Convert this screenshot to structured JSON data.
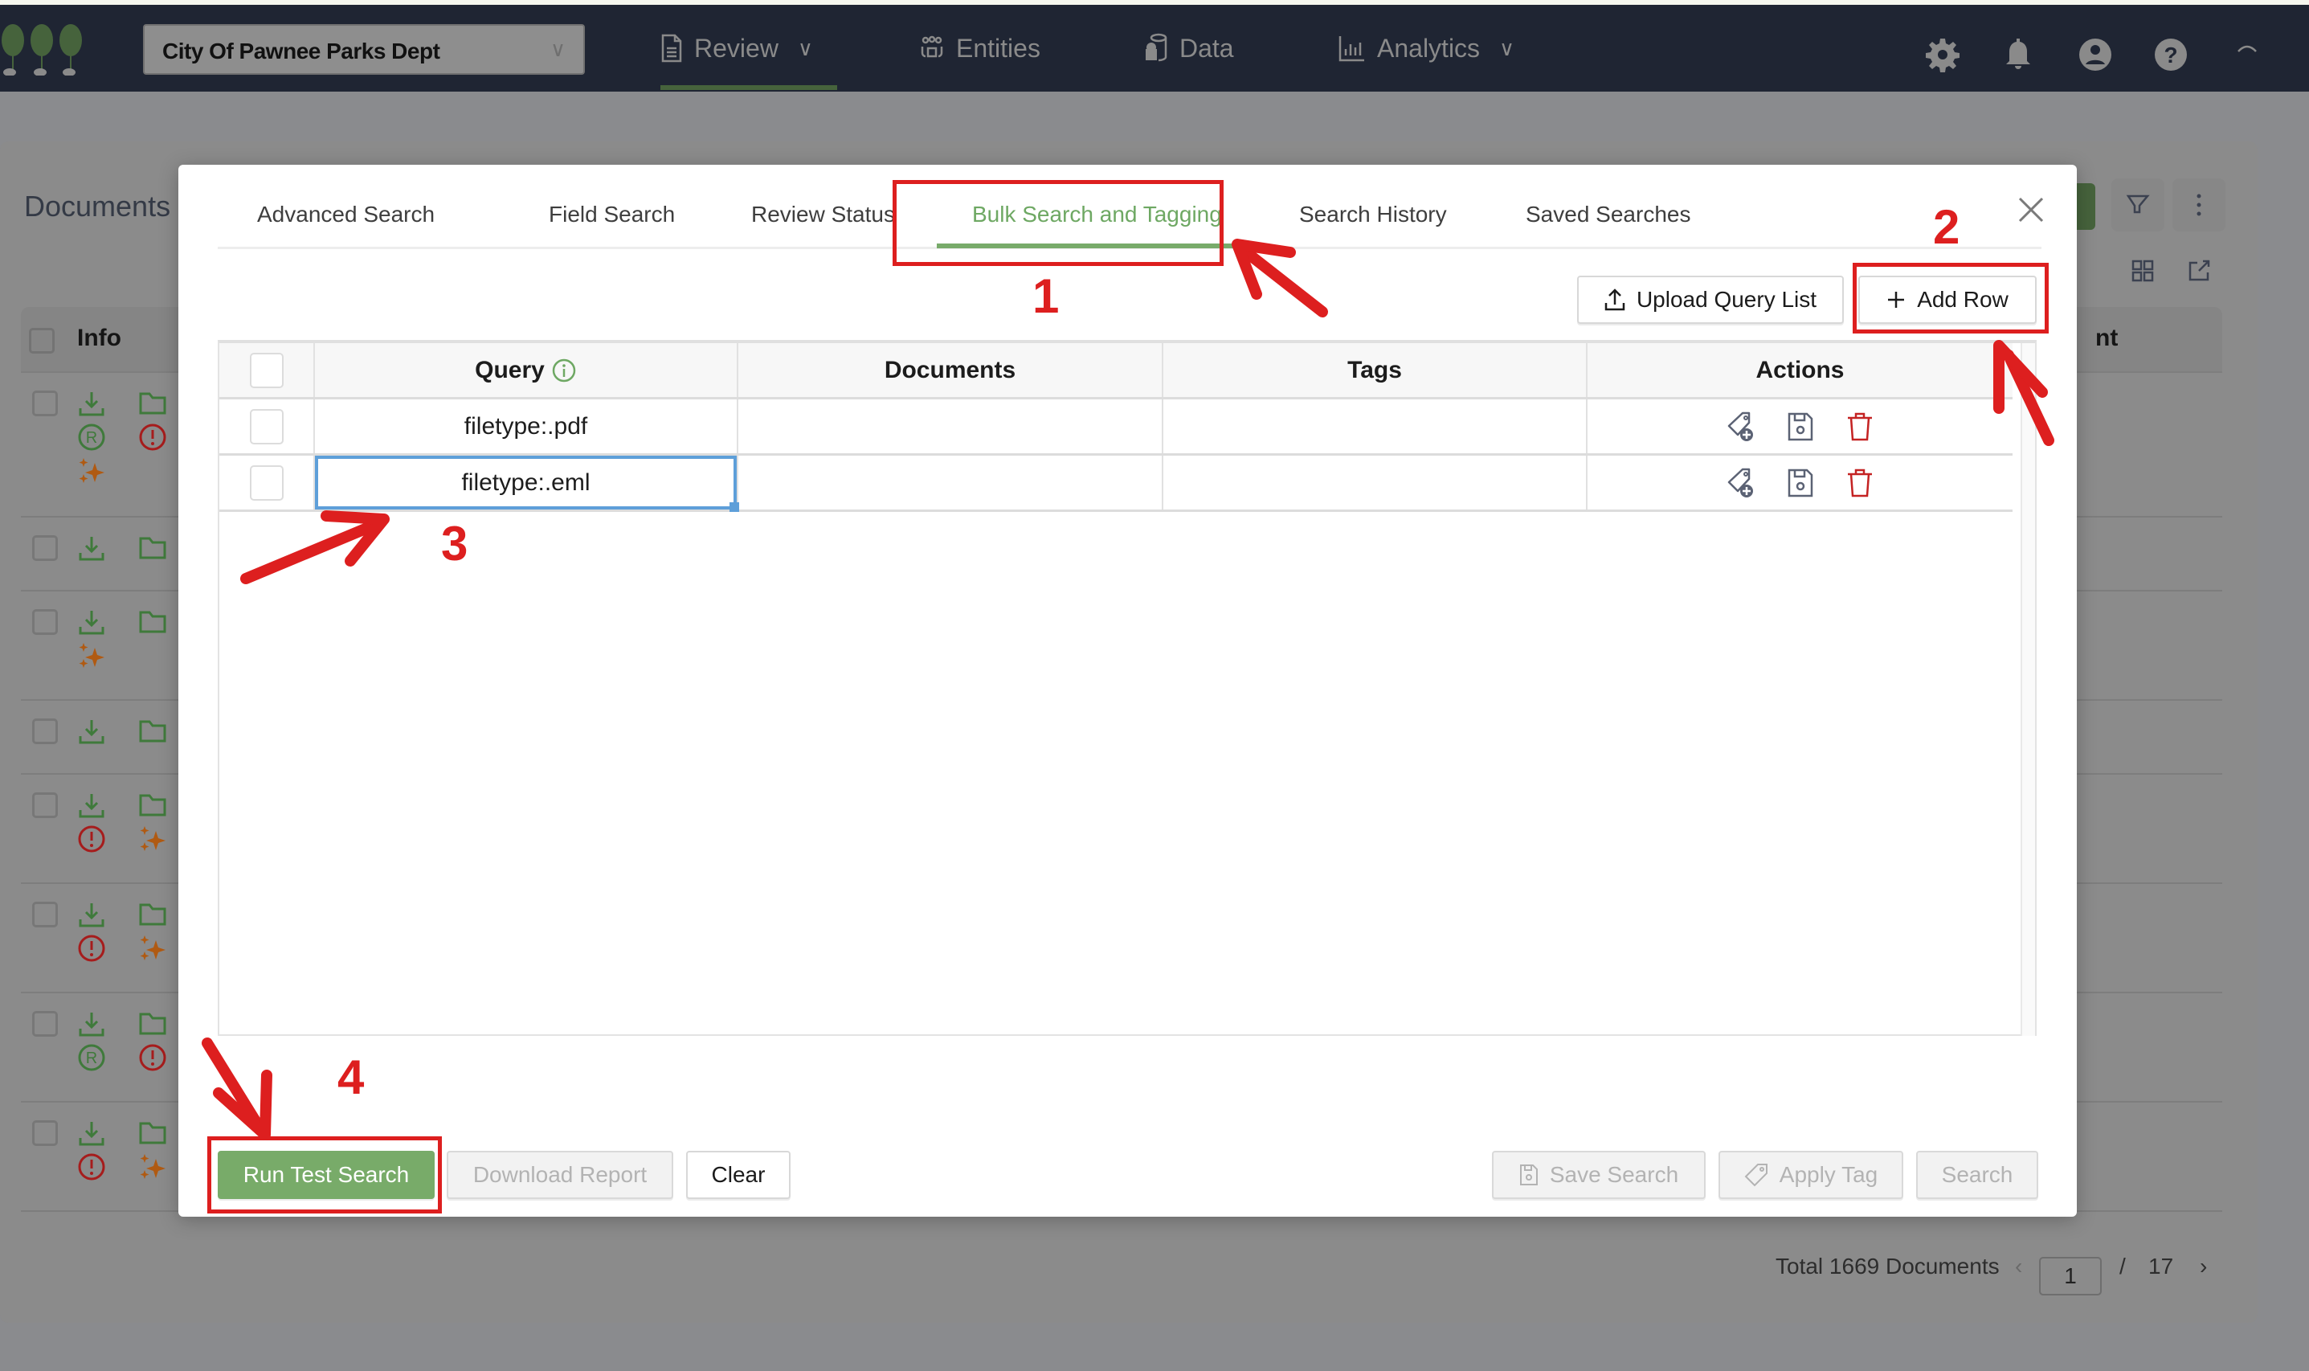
{
  "navbar": {
    "org_select": "City Of Pawnee Parks Dept",
    "items": [
      {
        "label": "Review",
        "icon": "document-icon",
        "has_dropdown": true,
        "active": true
      },
      {
        "label": "Entities",
        "icon": "people-icon",
        "has_dropdown": false
      },
      {
        "label": "Data",
        "icon": "database-icon",
        "has_dropdown": false
      },
      {
        "label": "Analytics",
        "icon": "bar-chart-icon",
        "has_dropdown": true
      }
    ],
    "right_icons": [
      "gear-icon",
      "bell-icon",
      "user-icon",
      "help-icon",
      "collapse-icon"
    ],
    "accent_color": "#46633c"
  },
  "background": {
    "title": "Documents",
    "columns": [
      "Info",
      "nt"
    ],
    "rows": [
      {
        "icons": [
          "download",
          "folder",
          "registered",
          "alert",
          "sparkle"
        ]
      },
      {
        "icons": [
          "download",
          "folder"
        ]
      },
      {
        "icons": [
          "download",
          "folder",
          "sparkle"
        ]
      },
      {
        "icons": [
          "download",
          "folder"
        ]
      },
      {
        "icons": [
          "download",
          "folder",
          "alert",
          "sparkle"
        ]
      },
      {
        "icons": [
          "download",
          "folder",
          "alert",
          "sparkle"
        ]
      },
      {
        "icons": [
          "download",
          "folder",
          "registered",
          "alert"
        ]
      },
      {
        "icons": [
          "download",
          "folder",
          "alert",
          "sparkle"
        ]
      }
    ],
    "pagination": {
      "total_label": "Total 1669 Documents",
      "current_page": "1",
      "separator": "/",
      "total_pages": "17"
    }
  },
  "modal": {
    "tabs": [
      {
        "label": "Advanced Search",
        "active": false
      },
      {
        "label": "Field Search",
        "active": false
      },
      {
        "label": "Review Status",
        "active": false
      },
      {
        "label": "Bulk Search and Tagging",
        "active": true
      },
      {
        "label": "Search History",
        "active": false
      },
      {
        "label": "Saved Searches",
        "active": false
      }
    ],
    "accent_color": "#78ab69",
    "toolbar": {
      "upload_label": "Upload Query List",
      "add_row_label": "Add Row"
    },
    "table": {
      "headers": {
        "query": "Query",
        "documents": "Documents",
        "tags": "Tags",
        "actions": "Actions"
      },
      "rows": [
        {
          "query": "filetype:.pdf",
          "documents": "",
          "tags": "",
          "selected": false,
          "editing": false
        },
        {
          "query": "filetype:.eml",
          "documents": "",
          "tags": "",
          "selected": false,
          "editing": true
        }
      ],
      "row_actions": [
        "add-tag-icon",
        "save-icon",
        "delete-icon"
      ]
    },
    "footer": {
      "run_test_search": "Run Test Search",
      "download_report": "Download Report",
      "clear": "Clear",
      "save_search": "Save Search",
      "apply_tag": "Apply Tag",
      "search": "Search"
    }
  },
  "annotations": {
    "color": "#dd1f1f",
    "steps": [
      "1",
      "2",
      "3",
      "4"
    ]
  }
}
